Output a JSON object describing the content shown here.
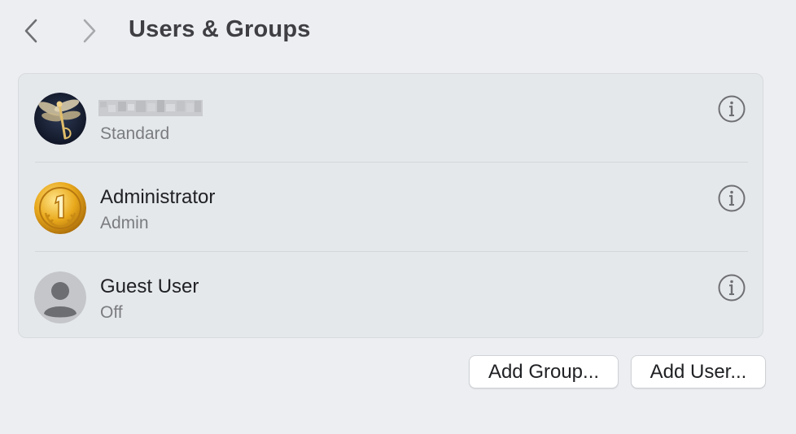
{
  "toolbar": {
    "title": "Users & Groups"
  },
  "users": [
    {
      "name": "",
      "role": "Standard",
      "avatar": "dragonfly-avatar"
    },
    {
      "name": "Administrator",
      "role": "Admin",
      "avatar": "gold-medal-avatar"
    },
    {
      "name": "Guest User",
      "role": "Off",
      "avatar": "generic-person-avatar"
    }
  ],
  "actions": {
    "add_group": "Add Group...",
    "add_user": "Add User..."
  },
  "colors": {
    "background": "#eceef1",
    "panel": "#e5e8eb",
    "icon_gray": "#6e6f73"
  }
}
